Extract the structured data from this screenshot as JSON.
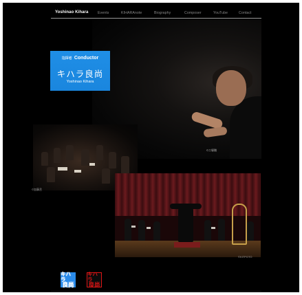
{
  "nav": {
    "items": [
      {
        "label": "Yoshinao Kihara",
        "active": true
      },
      {
        "label": "Events",
        "active": false
      },
      {
        "label": "KIHARAnote",
        "active": false
      },
      {
        "label": "Biography",
        "active": false
      },
      {
        "label": "Composer",
        "active": false
      },
      {
        "label": "YouTube",
        "active": false
      },
      {
        "label": "Contact",
        "active": false
      }
    ]
  },
  "hero": {
    "role_jp": "指揮者",
    "role_en": "Conductor",
    "name_jp": "キハラ良尚",
    "name_en": "Yoshinao Kihara",
    "photo_credit": "©二塚剛"
  },
  "photo1": {
    "credit": "©加藤丞"
  },
  "photo2": {
    "credit": "©KITPOTO"
  },
  "logos": {
    "blue": {
      "line1": "キハラ",
      "line2": "良尚"
    },
    "red": {
      "line1": "キハラ",
      "line2": "良尚"
    }
  },
  "colors": {
    "background": "#000000",
    "accent_blue": "#1f8ee6",
    "logo_red": "#e01515"
  }
}
